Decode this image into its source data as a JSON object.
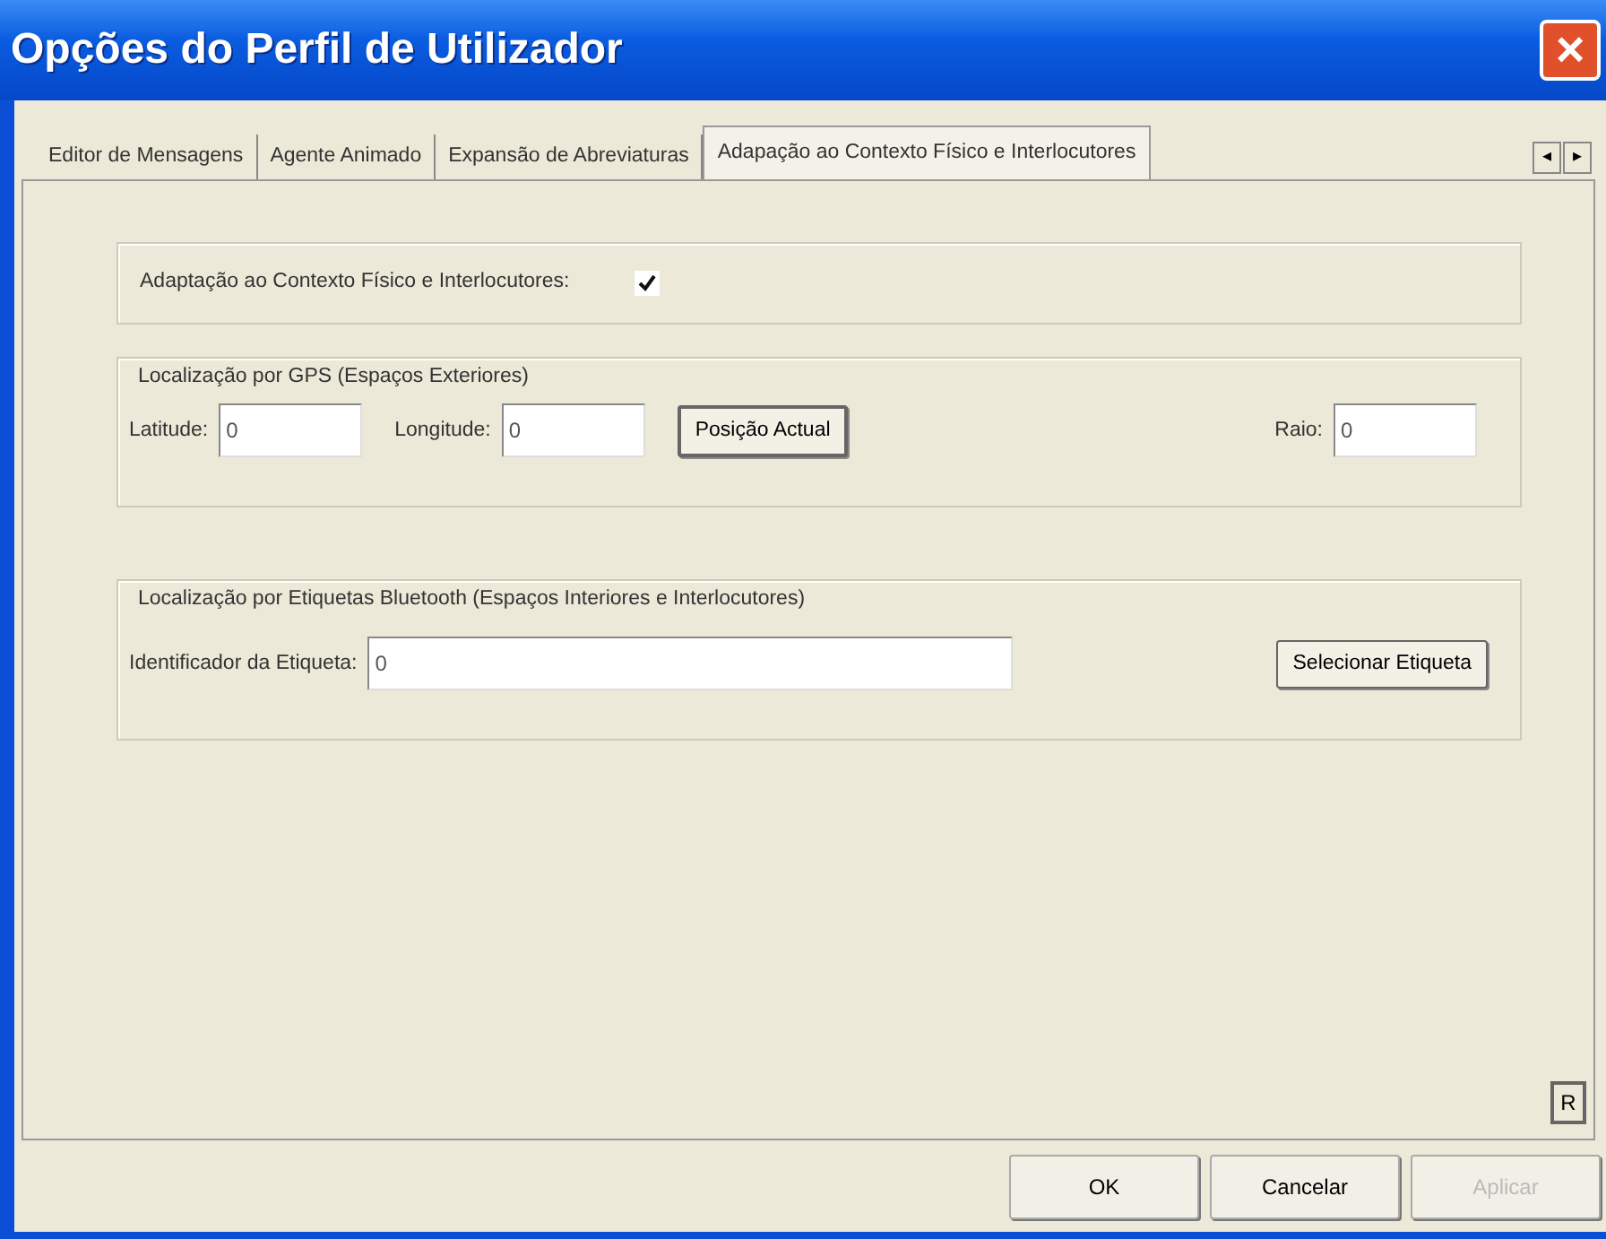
{
  "window": {
    "title": "Opções do Perfil de Utilizador",
    "close": "×"
  },
  "tabs": [
    {
      "label": "Editor de Mensagens",
      "selected": false
    },
    {
      "label": "Agente Animado",
      "selected": false
    },
    {
      "label": "Expansão de Abreviaturas",
      "selected": false
    },
    {
      "label": "Adapação ao Contexto Físico e Interlocutores",
      "selected": true
    }
  ],
  "tab_scroll": [
    "◂",
    "▸"
  ],
  "adaptation": {
    "label": "Adaptação ao Contexto Físico e Interlocutores:",
    "checked": true
  },
  "gps": {
    "legend": "Localização por GPS (Espaços Exteriores)",
    "fields": [
      {
        "label": "Latitude:",
        "value": "0"
      },
      {
        "label": "Longitude:",
        "value": "0"
      }
    ],
    "button": "Posição Actual",
    "radius": {
      "label": "Raio:",
      "value": "0"
    }
  },
  "bluetooth": {
    "legend": "Localização por Etiquetas Bluetooth (Espaços Interiores e Interlocutores)",
    "field": {
      "label": "Identificador da Etiqueta:",
      "value": "0"
    },
    "button": "Selecionar Etiqueta"
  },
  "corner_button": "R",
  "buttons": [
    {
      "label": "OK",
      "disabled": false
    },
    {
      "label": "Cancelar",
      "disabled": false
    },
    {
      "label": "Aplicar",
      "disabled": true
    }
  ]
}
